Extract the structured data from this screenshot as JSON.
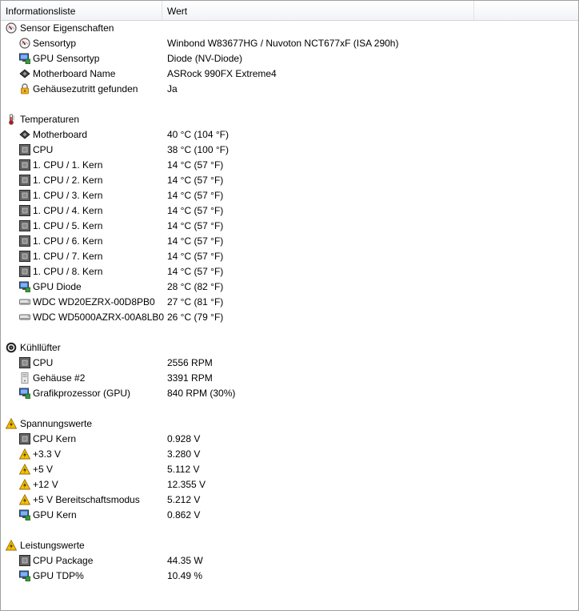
{
  "columns": {
    "name": "Informationsliste",
    "value": "Wert"
  },
  "colors": {
    "header_bg": "#f1f3f6",
    "border": "#a0a0a0",
    "warning": "#f2c200",
    "gpu": "#2c6bd1",
    "chip": "#505050"
  },
  "groups": [
    {
      "label": "Sensor Eigenschaften",
      "icon": "gauge-icon",
      "items": [
        {
          "label": "Sensortyp",
          "value": "Winbond W83677HG / Nuvoton NCT677xF  (ISA 290h)",
          "icon": "gauge-icon"
        },
        {
          "label": "GPU Sensortyp",
          "value": "Diode  (NV-Diode)",
          "icon": "gpu-monitor-icon"
        },
        {
          "label": "Motherboard Name",
          "value": "ASRock 990FX Extreme4",
          "icon": "motherboard-icon"
        },
        {
          "label": "Gehäusezutritt gefunden",
          "value": "Ja",
          "icon": "lock-icon"
        }
      ]
    },
    {
      "label": "Temperaturen",
      "icon": "thermometer-icon",
      "items": [
        {
          "label": "Motherboard",
          "value": "40 °C  (104 °F)",
          "icon": "motherboard-icon"
        },
        {
          "label": "CPU",
          "value": "38 °C  (100 °F)",
          "icon": "cpu-chip-icon"
        },
        {
          "label": "1. CPU / 1. Kern",
          "value": "14 °C  (57 °F)",
          "icon": "cpu-chip-icon"
        },
        {
          "label": "1. CPU / 2. Kern",
          "value": "14 °C  (57 °F)",
          "icon": "cpu-chip-icon"
        },
        {
          "label": "1. CPU / 3. Kern",
          "value": "14 °C  (57 °F)",
          "icon": "cpu-chip-icon"
        },
        {
          "label": "1. CPU / 4. Kern",
          "value": "14 °C  (57 °F)",
          "icon": "cpu-chip-icon"
        },
        {
          "label": "1. CPU / 5. Kern",
          "value": "14 °C  (57 °F)",
          "icon": "cpu-chip-icon"
        },
        {
          "label": "1. CPU / 6. Kern",
          "value": "14 °C  (57 °F)",
          "icon": "cpu-chip-icon"
        },
        {
          "label": "1. CPU / 7. Kern",
          "value": "14 °C  (57 °F)",
          "icon": "cpu-chip-icon"
        },
        {
          "label": "1. CPU / 8. Kern",
          "value": "14 °C  (57 °F)",
          "icon": "cpu-chip-icon"
        },
        {
          "label": "GPU Diode",
          "value": "28 °C  (82 °F)",
          "icon": "gpu-monitor-icon"
        },
        {
          "label": "WDC WD20EZRX-00D8PB0",
          "value": "27 °C  (81 °F)",
          "icon": "hard-drive-icon"
        },
        {
          "label": "WDC WD5000AZRX-00A8LB0",
          "value": "26 °C  (79 °F)",
          "icon": "hard-drive-icon"
        }
      ]
    },
    {
      "label": "Kühllüfter",
      "icon": "fan-icon",
      "items": [
        {
          "label": "CPU",
          "value": "2556 RPM",
          "icon": "cpu-chip-icon"
        },
        {
          "label": "Gehäuse #2",
          "value": "3391 RPM",
          "icon": "case-icon"
        },
        {
          "label": "Grafikprozessor (GPU)",
          "value": "840 RPM  (30%)",
          "icon": "gpu-monitor-icon"
        }
      ]
    },
    {
      "label": "Spannungswerte",
      "icon": "warning-voltage-icon",
      "items": [
        {
          "label": "CPU Kern",
          "value": "0.928 V",
          "icon": "cpu-chip-icon"
        },
        {
          "label": "+3.3 V",
          "value": "3.280 V",
          "icon": "warning-voltage-icon"
        },
        {
          "label": "+5 V",
          "value": "5.112 V",
          "icon": "warning-voltage-icon"
        },
        {
          "label": "+12 V",
          "value": "12.355 V",
          "icon": "warning-voltage-icon"
        },
        {
          "label": "+5 V Bereitschaftsmodus",
          "value": "5.212 V",
          "icon": "warning-voltage-icon"
        },
        {
          "label": "GPU Kern",
          "value": "0.862 V",
          "icon": "gpu-monitor-icon"
        }
      ]
    },
    {
      "label": "Leistungswerte",
      "icon": "warning-voltage-icon",
      "items": [
        {
          "label": "CPU Package",
          "value": "44.35 W",
          "icon": "cpu-chip-icon"
        },
        {
          "label": "GPU TDP%",
          "value": "10.49 %",
          "icon": "gpu-monitor-icon"
        }
      ]
    }
  ]
}
